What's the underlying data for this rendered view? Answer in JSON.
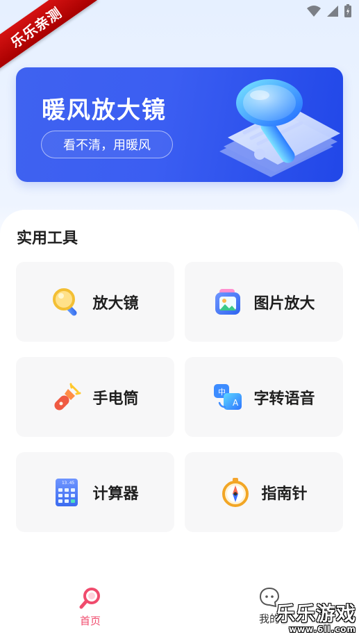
{
  "corner_ribbon": {
    "text": "乐乐亲测"
  },
  "status_bar": {
    "icons": [
      "notification-icon",
      "wifi-icon",
      "signal-icon",
      "battery-icon"
    ]
  },
  "banner": {
    "title": "暖风放大镜",
    "slogan": "看不清，用暖风"
  },
  "tools": {
    "section_title": "实用工具",
    "items": [
      {
        "label": "放大镜",
        "icon": "magnifier-icon"
      },
      {
        "label": "图片放大",
        "icon": "image-icon"
      },
      {
        "label": "手电筒",
        "icon": "flashlight-icon"
      },
      {
        "label": "字转语音",
        "icon": "text-to-speech-icon"
      },
      {
        "label": "计算器",
        "icon": "calculator-icon"
      },
      {
        "label": "指南针",
        "icon": "compass-icon"
      }
    ]
  },
  "bottom_nav": {
    "home_label": "首页",
    "mine_label": "我的"
  },
  "watermark": {
    "text": "乐乐游戏",
    "url": "www.6ll.com"
  },
  "colors": {
    "banner_blue": "#3b5ef2",
    "home_pink": "#f04b6d",
    "ribbon_red": "#d51212"
  }
}
